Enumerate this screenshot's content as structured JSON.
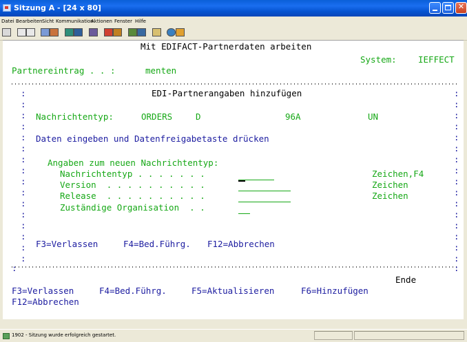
{
  "window": {
    "title": "Sitzung A - [24 x 80]"
  },
  "menu": [
    "Datei",
    "Bearbeiten",
    "Sicht",
    "Kommunikation",
    "Aktionen",
    "Fenster",
    "Hilfe"
  ],
  "screen": {
    "header_title": "Mit EDIFACT-Partnerdaten arbeiten",
    "system_label": "System:",
    "system_value": "IEFFECT",
    "partner_label": "Partnereintrag . . :",
    "partner_value": "menten",
    "dialog_title": "EDI-Partnerangaben hinzufügen",
    "msgtype_label": "Nachrichtentyp:",
    "msgtype_values": [
      "ORDERS",
      "D",
      "96A",
      "UN"
    ],
    "instruction": "Daten eingeben und Datenfreigabetaste drücken",
    "section_title": "Angaben zum neuen Nachrichtentyp:",
    "fields": [
      {
        "label": "Nachrichtentyp . . . . . . .",
        "value": "",
        "hint": "Zeichen,F4"
      },
      {
        "label": "Version  . . . . . . . . . .",
        "value": "",
        "hint": "Zeichen"
      },
      {
        "label": "Release  . . . . . . . . . .",
        "value": "",
        "hint": "Zeichen"
      },
      {
        "label": "Zuständige Organisation  . .",
        "value": "",
        "hint": ""
      }
    ],
    "dialog_fkeys": [
      "F3=Verlassen",
      "F4=Bed.Führg.",
      "F12=Abbrechen"
    ],
    "end_label": "Ende",
    "fkeys_line1": [
      "F3=Verlassen",
      "F4=Bed.Führg.",
      "F5=Aktualisieren",
      "F6=Hinzufügen"
    ],
    "fkeys_line2": [
      "F12=Abbrechen"
    ]
  },
  "status": {
    "message": "1902 - Sitzung wurde erfolgreich gestartet."
  },
  "colors": {
    "green": "#16a816",
    "blue": "#1c1ca0",
    "titlebar": "#0a5fd8"
  }
}
